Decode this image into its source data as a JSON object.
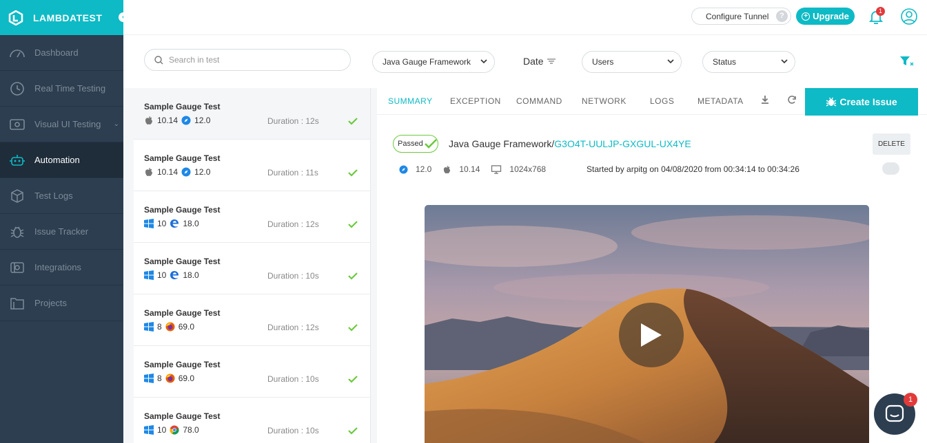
{
  "brand": {
    "name": "LAMBDATEST"
  },
  "sidebar": {
    "items": [
      {
        "label": "Dashboard",
        "icon": "dashboard-icon"
      },
      {
        "label": "Real Time Testing",
        "icon": "clock-icon"
      },
      {
        "label": "Visual UI Testing",
        "icon": "eye-icon"
      },
      {
        "label": "Automation",
        "icon": "robot-icon",
        "active": true
      },
      {
        "label": "Test Logs",
        "icon": "box-icon"
      },
      {
        "label": "Issue Tracker",
        "icon": "bug-icon"
      },
      {
        "label": "Integrations",
        "icon": "integrations-icon"
      },
      {
        "label": "Projects",
        "icon": "folder-icon"
      }
    ]
  },
  "header": {
    "configure_tunnel": "Configure Tunnel",
    "tunnel_help": "?",
    "upgrade": "Upgrade",
    "notification_count": "1"
  },
  "filters": {
    "search_placeholder": "Search in test",
    "framework": "Java Gauge Framework",
    "date": "Date",
    "users": "Users",
    "status": "Status"
  },
  "tests": [
    {
      "name": "Sample Gauge Test",
      "os": "mac",
      "os_version": "10.14",
      "browser": "safari",
      "browser_version": "12.0",
      "duration": "Duration : 12s"
    },
    {
      "name": "Sample Gauge Test",
      "os": "mac",
      "os_version": "10.14",
      "browser": "safari",
      "browser_version": "12.0",
      "duration": "Duration : 11s"
    },
    {
      "name": "Sample Gauge Test",
      "os": "windows",
      "os_version": "10",
      "browser": "edge",
      "browser_version": "18.0",
      "duration": "Duration : 12s"
    },
    {
      "name": "Sample Gauge Test",
      "os": "windows",
      "os_version": "10",
      "browser": "edge",
      "browser_version": "18.0",
      "duration": "Duration : 10s"
    },
    {
      "name": "Sample Gauge Test",
      "os": "windows",
      "os_version": "8",
      "browser": "firefox",
      "browser_version": "69.0",
      "duration": "Duration : 12s"
    },
    {
      "name": "Sample Gauge Test",
      "os": "windows",
      "os_version": "8",
      "browser": "firefox",
      "browser_version": "69.0",
      "duration": "Duration : 10s"
    },
    {
      "name": "Sample Gauge Test",
      "os": "windows",
      "os_version": "10",
      "browser": "chrome",
      "browser_version": "78.0",
      "duration": "Duration : 10s"
    }
  ],
  "detail": {
    "tabs": [
      "SUMMARY",
      "EXCEPTION",
      "COMMAND",
      "NETWORK",
      "LOGS",
      "METADATA"
    ],
    "create_issue": "Create Issue",
    "status": "Passed",
    "framework": "Java Gauge Framework/",
    "test_id": "G3O4T-UULJP-GXGUL-UX4YE",
    "delete": "DELETE",
    "browser_version": "12.0",
    "os_version": "10.14",
    "resolution": "1024x768",
    "started": "Started by arpitg on 04/08/2020 from 00:34:14 to 00:34:26"
  },
  "chat": {
    "badge": "1"
  },
  "colors": {
    "accent": "#0ebac5",
    "sidebar": "#2d3e50",
    "success": "#6cc93e"
  }
}
